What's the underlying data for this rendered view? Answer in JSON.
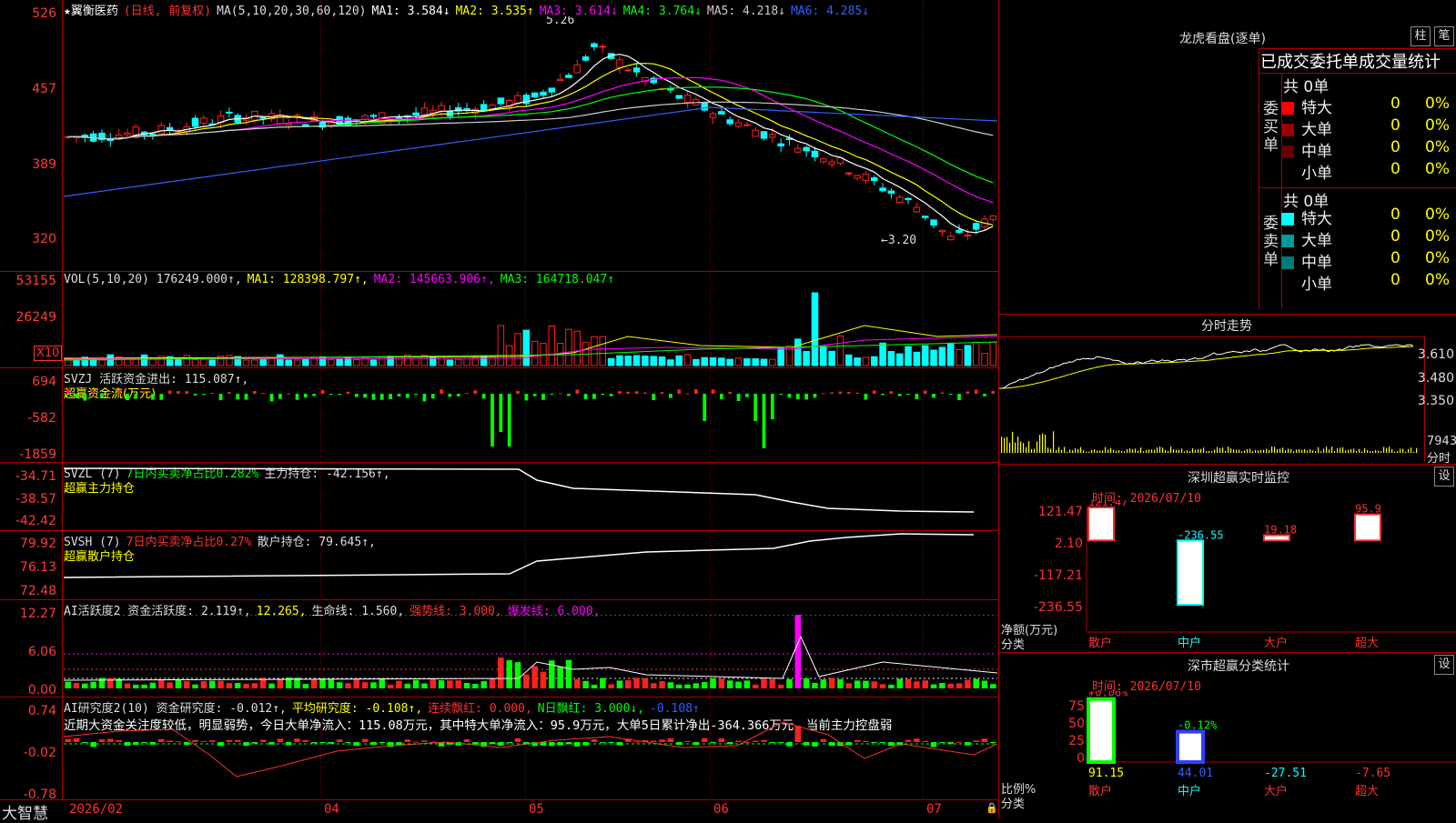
{
  "main_chart": {
    "stock_name": "★翼衡医药",
    "period_label": "(日线, 前复权)",
    "ma_prefix": "MA(5,10,20,30,60,120)",
    "ma_values": [
      {
        "label": "MA1: 3.584↓",
        "color": "#ffffff"
      },
      {
        "label": "MA2: 3.535↑",
        "color": "#ffff00"
      },
      {
        "label": "MA3: 3.614↓",
        "color": "#ff00ff"
      },
      {
        "label": "MA4: 3.764↓",
        "color": "#00ff00"
      },
      {
        "label": "MA5: 4.218↓",
        "color": "#cccccc"
      },
      {
        "label": "MA6: 4.285↓",
        "color": "#3060ff"
      }
    ],
    "y_ticks": [
      "526",
      "457",
      "389",
      "320"
    ],
    "high_marker": "5.26",
    "low_marker": "←3.20",
    "up_color": "#ff2020",
    "down_color": "#00ffff"
  },
  "volume_panel": {
    "header": [
      {
        "label": "VOL(5,10,20) 176249.000↑,",
        "color": "#dddddd"
      },
      {
        "label": "MA1: 128398.797↑,",
        "color": "#ffff00"
      },
      {
        "label": "MA2: 145663.906↑,",
        "color": "#ff00ff"
      },
      {
        "label": "MA3: 164718.047↑",
        "color": "#00ff00"
      }
    ],
    "y_ticks": [
      "53155",
      "26249"
    ],
    "unit_badge": "X10"
  },
  "svzj_panel": {
    "header": [
      {
        "label": "SVZJ  活跃资金进出: 115.087↑,",
        "color": "#dddddd"
      }
    ],
    "subtitle": "超赢资金流(万元)",
    "y_ticks": [
      "694",
      "-582",
      "-1859"
    ]
  },
  "svzl_panel": {
    "header": [
      {
        "label": "SVZL (7)",
        "color": "#dddddd"
      },
      {
        "label": "7日内买卖净占比0.282%",
        "color": "#00ff00"
      },
      {
        "label": "主力持仓: -42.156↑,",
        "color": "#dddddd"
      }
    ],
    "subtitle": "超赢主力持仓",
    "y_ticks": [
      "-34.71",
      "-38.57",
      "-42.42"
    ]
  },
  "svsh_panel": {
    "header": [
      {
        "label": "SVSH (7)",
        "color": "#dddddd"
      },
      {
        "label": "7日内买卖净占比0.27%",
        "color": "#ff3030"
      },
      {
        "label": "散户持仓: 79.645↑,",
        "color": "#dddddd"
      }
    ],
    "subtitle": "超赢散户持仓",
    "y_ticks": [
      "79.92",
      "76.13",
      "72.48"
    ]
  },
  "ai_active_panel": {
    "header": [
      {
        "label": "AI活跃度2 资金活跃度: 2.119↑,",
        "color": "#dddddd"
      },
      {
        "label": "12.265,",
        "color": "#ffff00"
      },
      {
        "label": "生命线: 1.560,",
        "color": "#dddddd"
      },
      {
        "label": "强势线: 3.000,",
        "color": "#ff3030"
      },
      {
        "label": "爆发线: 6.000,",
        "color": "#ff00ff"
      }
    ],
    "y_ticks": [
      "12.27",
      "6.06",
      "0.00"
    ]
  },
  "ai_research_panel": {
    "header": [
      {
        "label": "AI研究度2(10) 资金研究度: -0.012↑,",
        "color": "#dddddd"
      },
      {
        "label": "平均研究度: -0.108↑,",
        "color": "#ffff00"
      },
      {
        "label": "连续飘红: 0.000,",
        "color": "#ff3030"
      },
      {
        "label": "N日飘红: 3.000↓,",
        "color": "#00ff00"
      },
      {
        "label": "-0.108↑",
        "color": "#3060ff"
      }
    ],
    "comment": "近期大资金关注度较低，明显弱势，今日大单净流入：115.08万元，其中特大单净流入：95.9万元，大单5日累计净出-364.366万元，当前主力控盘弱",
    "y_ticks": [
      "0.74",
      "-0.02",
      "-0.78"
    ]
  },
  "bottom_axis": {
    "brand": "大智慧",
    "months": [
      "2026/02",
      "04",
      "05",
      "06",
      "07"
    ]
  },
  "right_panel": {
    "dragon_title": "龙虎看盘(逐单)",
    "btn_bar": "柱",
    "btn_pen": "笔",
    "order_title": "已成交委托单成交量统计",
    "buy_side_label": "委买单",
    "sell_side_label": "委卖单",
    "buy_total": "共 0单",
    "sell_total": "共 0单",
    "buy_rows": [
      {
        "label": "特大",
        "color": "#ff0000",
        "count": "0",
        "pct": "0%"
      },
      {
        "label": "大单",
        "color": "#990000",
        "count": "0",
        "pct": "0%"
      },
      {
        "label": "中单",
        "color": "#660000",
        "count": "0",
        "pct": "0%"
      },
      {
        "label": "小单",
        "color": "",
        "count": "0",
        "pct": "0%"
      }
    ],
    "sell_rows": [
      {
        "label": "特大",
        "color": "#00ffff",
        "count": "0",
        "pct": "0%"
      },
      {
        "label": "大单",
        "color": "#009a9a",
        "count": "0",
        "pct": "0%"
      },
      {
        "label": "中单",
        "color": "#007a7a",
        "count": "0",
        "pct": "0%"
      },
      {
        "label": "小单",
        "color": "",
        "count": "0",
        "pct": "0%"
      }
    ],
    "intraday_title": "分时走势",
    "intraday_ticks": [
      "3.610",
      "3.480",
      "3.350"
    ],
    "intraday_vol": "7943",
    "intraday_vol_label": "分时",
    "sz_monitor_title": "深圳超赢实时监控",
    "sz_monitor_btn": "设",
    "sz_monitor_time": "时间: 2026/07/10",
    "sz_monitor_ticks": [
      "121.47",
      "2.10",
      "-117.21",
      "-236.55"
    ],
    "sz_monitor_axis_label": "净额(万元)",
    "sz_monitor_cat_label": "分类",
    "sz_monitor_chart": {
      "type": "bar",
      "categories": [
        "散户",
        "中户",
        "大户",
        "超大"
      ],
      "values": [
        121.47,
        -236.55,
        19.18,
        95.9
      ],
      "value_labels": [
        "121.47",
        "-236.55",
        "19.18",
        "95.9"
      ],
      "ylim": [
        -236.55,
        121.47
      ]
    },
    "sz_class_title": "深市超赢分类统计",
    "sz_class_btn": "设",
    "sz_class_time": "时间: 2026/07/10",
    "sz_class_ticks": [
      "75",
      "50",
      "25",
      "0"
    ],
    "sz_class_axis_label": "比例%",
    "sz_class_cat_label": "分类",
    "sz_class_chart": {
      "type": "bar",
      "categories": [
        "散户",
        "中户",
        "大户",
        "超大"
      ],
      "values": [
        91.15,
        44.01,
        -27.51,
        -7.65
      ],
      "value_labels": [
        "91.15",
        "44.01",
        "-27.51",
        "-7.65"
      ],
      "change_labels": [
        "+0.06%",
        "-0.12%",
        "",
        ""
      ],
      "ylim": [
        0,
        100
      ]
    }
  }
}
